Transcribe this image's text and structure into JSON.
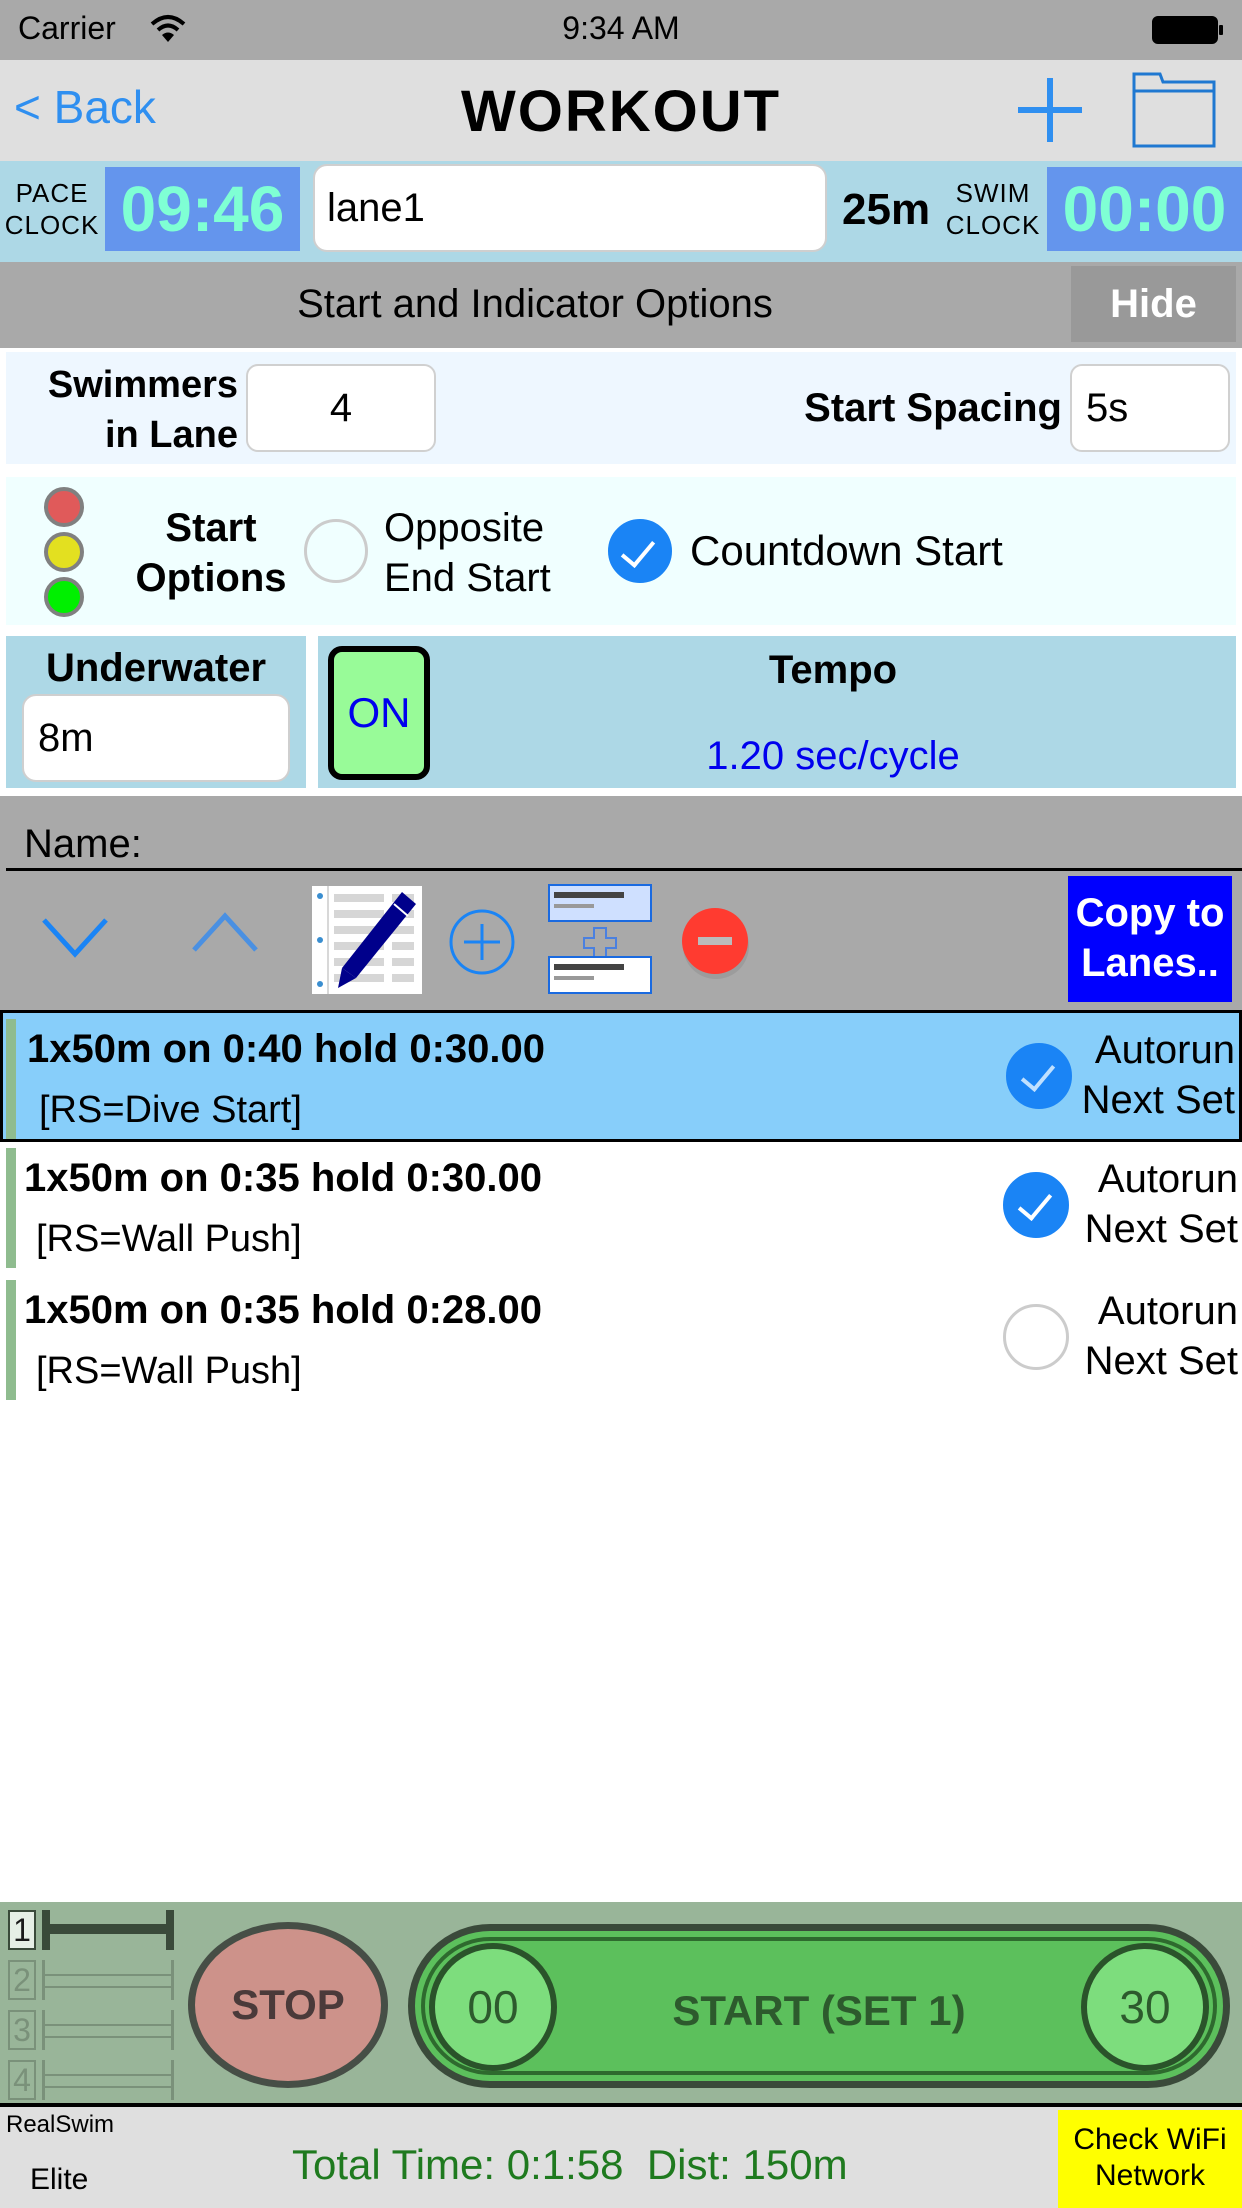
{
  "status_bar": {
    "carrier": "Carrier",
    "time": "9:34 AM",
    "wifi_icon": "wifi-icon",
    "battery_icon": "battery-full-icon"
  },
  "nav": {
    "back_label": "< Back",
    "title": "WORKOUT",
    "add_icon": "plus-icon",
    "folder_icon": "folder-icon",
    "accent_color": "#2f8ff0"
  },
  "clocks": {
    "pace_label_1": "PACE",
    "pace_label_2": "CLOCK",
    "pace_value": "09:46",
    "lane_name": "lane1",
    "pool_length": "25m",
    "swim_label_1": "SWIM",
    "swim_label_2": "CLOCK",
    "swim_value": "00:00",
    "clock_bg": "#6495ed",
    "clock_fg": "#7fffd4"
  },
  "options": {
    "title": "Start and Indicator Options",
    "hide_label": "Hide",
    "swimmers_label_1": "Swimmers",
    "swimmers_label_2": "in Lane",
    "swimmers_value": "4",
    "spacing_label": "Start Spacing",
    "spacing_value": "5s",
    "start_options_label_1": "Start",
    "start_options_label_2": "Options",
    "opposite_label_1": "Opposite",
    "opposite_label_2": "End Start",
    "opposite_checked": false,
    "countdown_label": "Countdown Start",
    "countdown_checked": true,
    "underwater_label": "Underwater",
    "underwater_value": "8m",
    "tempo_toggle": "ON",
    "tempo_label": "Tempo",
    "tempo_value": "1.20 sec/cycle"
  },
  "workout": {
    "name_label": "Name:",
    "name_value": "",
    "copy_label_1": "Copy to",
    "copy_label_2": "Lanes..",
    "toolbar_icons": [
      "chevron-down-icon",
      "chevron-up-icon",
      "edit-list-icon",
      "add-circle-icon",
      "duplicate-set-icon",
      "delete-circle-icon"
    ]
  },
  "sets": [
    {
      "title": "1x50m on 0:40 hold 0:30.00",
      "sub": "[RS=Dive Start]",
      "autorun_1": "Autorun",
      "autorun_2": "Next Set",
      "autorun": true,
      "selected": true
    },
    {
      "title": "1x50m on 0:35 hold 0:30.00",
      "sub": "[RS=Wall Push]",
      "autorun_1": "Autorun",
      "autorun_2": "Next Set",
      "autorun": true,
      "selected": false
    },
    {
      "title": "1x50m on 0:35 hold 0:28.00",
      "sub": "[RS=Wall Push]",
      "autorun_1": "Autorun",
      "autorun_2": "Next Set",
      "autorun": false,
      "selected": false
    }
  ],
  "controls": {
    "lanes": [
      "1",
      "2",
      "3",
      "4"
    ],
    "active_lane": "1",
    "stop_label": "STOP",
    "start_label": "START (SET 1)",
    "start_left_count": "00",
    "start_right_count": "30"
  },
  "footer": {
    "app_name": "RealSwim",
    "app_tier": "Elite",
    "summary": "Total Time: 0:1:58  Dist: 150m",
    "wifi_label_1": "Check WiFi",
    "wifi_label_2": "Network"
  }
}
